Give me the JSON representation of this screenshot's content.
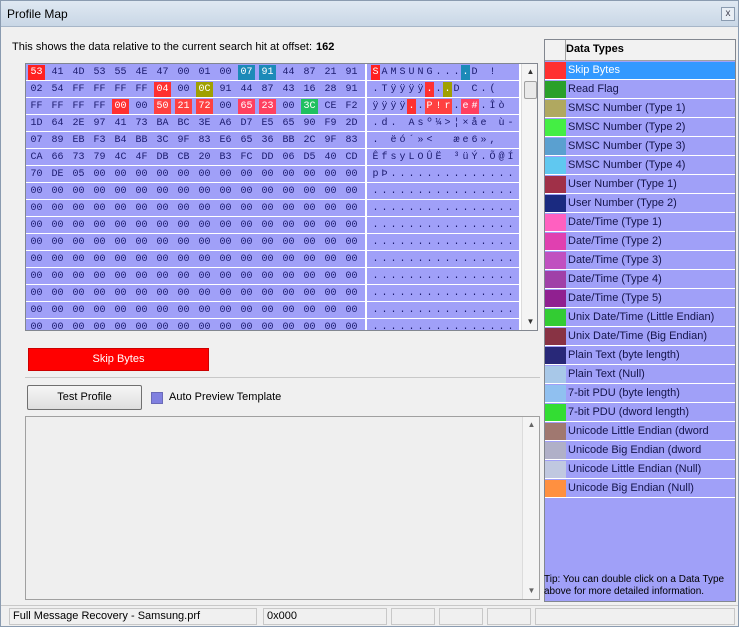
{
  "window": {
    "title": "Profile Map",
    "close_label": "x"
  },
  "info": {
    "text": "This shows the data relative to the current search hit at offset:",
    "offset": "162"
  },
  "hex_rows": [
    {
      "hex": [
        "53",
        "41",
        "4D",
        "53",
        "55",
        "4E",
        "47",
        "00",
        "01",
        "00",
        "07",
        "91",
        "44",
        "87",
        "21",
        "91"
      ],
      "ascii": [
        "S",
        "A",
        "M",
        "S",
        "U",
        "N",
        "G",
        ".",
        ".",
        ".",
        ".",
        "D",
        " ",
        "!",
        " ",
        " "
      ]
    },
    {
      "hex": [
        "02",
        "54",
        "FF",
        "FF",
        "FF",
        "FF",
        "04",
        "00",
        "0C",
        "91",
        "44",
        "87",
        "43",
        "16",
        "28",
        "91"
      ],
      "ascii": [
        ".",
        "T",
        "ÿ",
        "ÿ",
        "ÿ",
        "ÿ",
        ".",
        ".",
        ".",
        "D",
        " ",
        "C",
        ".",
        "(",
        " ",
        " "
      ]
    },
    {
      "hex": [
        "FF",
        "FF",
        "FF",
        "FF",
        "00",
        "00",
        "50",
        "21",
        "72",
        "00",
        "65",
        "23",
        "00",
        "3C",
        "CE",
        "F2"
      ],
      "ascii": [
        "ÿ",
        "ÿ",
        "ÿ",
        "ÿ",
        ".",
        ".",
        "P",
        "!",
        "r",
        ".",
        "e",
        "#",
        ".",
        "Î",
        "ò",
        " "
      ]
    },
    {
      "hex": [
        "1D",
        "64",
        "2E",
        "97",
        "41",
        "73",
        "BA",
        "BC",
        "3E",
        "A6",
        "D7",
        "E5",
        "65",
        "90",
        "F9",
        "2D"
      ],
      "ascii": [
        ".",
        "d",
        ".",
        " ",
        "A",
        "s",
        "º",
        "¼",
        ">",
        "¦",
        "×",
        "å",
        "e",
        " ",
        "ù",
        "-"
      ]
    },
    {
      "hex": [
        "07",
        "89",
        "EB",
        "F3",
        "B4",
        "BB",
        "3C",
        "9F",
        "83",
        "E6",
        "65",
        "36",
        "BB",
        "2C",
        "9F",
        "83"
      ],
      "ascii": [
        ".",
        " ",
        "ë",
        "ó",
        "´",
        "»",
        "<",
        " ",
        " ",
        "æ",
        "e",
        "6",
        "»",
        ",",
        " ",
        " "
      ]
    },
    {
      "hex": [
        "CA",
        "66",
        "73",
        "79",
        "4C",
        "4F",
        "DB",
        "CB",
        "20",
        "B3",
        "FC",
        "DD",
        "06",
        "D5",
        "40",
        "CD"
      ],
      "ascii": [
        "Ê",
        "f",
        "s",
        "y",
        "L",
        "O",
        "Û",
        "Ë",
        " ",
        "³",
        "ü",
        "Ý",
        ".",
        "Õ",
        "@",
        "Í"
      ]
    },
    {
      "hex": [
        "70",
        "DE",
        "05",
        "00",
        "00",
        "00",
        "00",
        "00",
        "00",
        "00",
        "00",
        "00",
        "00",
        "00",
        "00",
        "00"
      ],
      "ascii": [
        "p",
        "Þ",
        ".",
        ".",
        ".",
        ".",
        ".",
        ".",
        ".",
        ".",
        ".",
        ".",
        ".",
        ".",
        ".",
        "."
      ]
    },
    {
      "hex": [
        "00",
        "00",
        "00",
        "00",
        "00",
        "00",
        "00",
        "00",
        "00",
        "00",
        "00",
        "00",
        "00",
        "00",
        "00",
        "00"
      ],
      "ascii": [
        ".",
        ".",
        ".",
        ".",
        ".",
        ".",
        ".",
        ".",
        ".",
        ".",
        ".",
        ".",
        ".",
        ".",
        ".",
        "."
      ]
    },
    {
      "hex": [
        "00",
        "00",
        "00",
        "00",
        "00",
        "00",
        "00",
        "00",
        "00",
        "00",
        "00",
        "00",
        "00",
        "00",
        "00",
        "00"
      ],
      "ascii": [
        ".",
        ".",
        ".",
        ".",
        ".",
        ".",
        ".",
        ".",
        ".",
        ".",
        ".",
        ".",
        ".",
        ".",
        ".",
        "."
      ]
    },
    {
      "hex": [
        "00",
        "00",
        "00",
        "00",
        "00",
        "00",
        "00",
        "00",
        "00",
        "00",
        "00",
        "00",
        "00",
        "00",
        "00",
        "00"
      ],
      "ascii": [
        ".",
        ".",
        ".",
        ".",
        ".",
        ".",
        ".",
        ".",
        ".",
        ".",
        ".",
        ".",
        ".",
        ".",
        ".",
        "."
      ]
    },
    {
      "hex": [
        "00",
        "00",
        "00",
        "00",
        "00",
        "00",
        "00",
        "00",
        "00",
        "00",
        "00",
        "00",
        "00",
        "00",
        "00",
        "00"
      ],
      "ascii": [
        ".",
        ".",
        ".",
        ".",
        ".",
        ".",
        ".",
        ".",
        ".",
        ".",
        ".",
        ".",
        ".",
        ".",
        ".",
        "."
      ]
    },
    {
      "hex": [
        "00",
        "00",
        "00",
        "00",
        "00",
        "00",
        "00",
        "00",
        "00",
        "00",
        "00",
        "00",
        "00",
        "00",
        "00",
        "00"
      ],
      "ascii": [
        ".",
        ".",
        ".",
        ".",
        ".",
        ".",
        ".",
        ".",
        ".",
        ".",
        ".",
        ".",
        ".",
        ".",
        ".",
        "."
      ]
    },
    {
      "hex": [
        "00",
        "00",
        "00",
        "00",
        "00",
        "00",
        "00",
        "00",
        "00",
        "00",
        "00",
        "00",
        "00",
        "00",
        "00",
        "00"
      ],
      "ascii": [
        ".",
        ".",
        ".",
        ".",
        ".",
        ".",
        ".",
        ".",
        ".",
        ".",
        ".",
        ".",
        ".",
        ".",
        ".",
        "."
      ]
    },
    {
      "hex": [
        "00",
        "00",
        "00",
        "00",
        "00",
        "00",
        "00",
        "00",
        "00",
        "00",
        "00",
        "00",
        "00",
        "00",
        "00",
        "00"
      ],
      "ascii": [
        ".",
        ".",
        ".",
        ".",
        ".",
        ".",
        ".",
        ".",
        ".",
        ".",
        ".",
        ".",
        ".",
        ".",
        ".",
        "."
      ]
    },
    {
      "hex": [
        "00",
        "00",
        "00",
        "00",
        "00",
        "00",
        "00",
        "00",
        "00",
        "00",
        "00",
        "00",
        "00",
        "00",
        "00",
        "00"
      ],
      "ascii": [
        ".",
        ".",
        ".",
        ".",
        ".",
        ".",
        ".",
        ".",
        ".",
        ".",
        ".",
        ".",
        ".",
        ".",
        ".",
        "."
      ]
    },
    {
      "hex": [
        "00",
        "00",
        "00",
        "00",
        "00",
        "00",
        "00",
        "00",
        "00",
        "00",
        "00",
        "00",
        "00",
        "00",
        "00",
        "00"
      ],
      "ascii": [
        ".",
        ".",
        ".",
        ".",
        ".",
        ".",
        ".",
        ".",
        ".",
        ".",
        ".",
        ".",
        ".",
        ".",
        ".",
        "."
      ]
    }
  ],
  "hex_highlights": [
    {
      "row": 0,
      "col": 0,
      "color": "#ff2020"
    },
    {
      "row": 0,
      "col": 10,
      "color": "#1c8ab8"
    },
    {
      "row": 0,
      "col": 11,
      "color": "#1c8ab8"
    },
    {
      "row": 1,
      "col": 6,
      "color": "#ff3030"
    },
    {
      "row": 1,
      "col": 8,
      "color": "#a0a000"
    },
    {
      "row": 2,
      "col": 4,
      "color": "#ff3030"
    },
    {
      "row": 2,
      "col": 6,
      "color": "#ff4040"
    },
    {
      "row": 2,
      "col": 7,
      "color": "#ff4040"
    },
    {
      "row": 2,
      "col": 8,
      "color": "#ff4040"
    },
    {
      "row": 2,
      "col": 10,
      "color": "#ff4060"
    },
    {
      "row": 2,
      "col": 11,
      "color": "#ff4060"
    },
    {
      "row": 2,
      "col": 13,
      "color": "#20c060"
    }
  ],
  "ascii_highlights": [
    {
      "row": 0,
      "col": 0,
      "color": "#ff2020"
    },
    {
      "row": 0,
      "col": 10,
      "color": "#1c8ab8"
    },
    {
      "row": 1,
      "col": 6,
      "color": "#ff3030"
    },
    {
      "row": 1,
      "col": 8,
      "color": "#a0a000"
    },
    {
      "row": 2,
      "col": 4,
      "color": "#ff3030"
    },
    {
      "row": 2,
      "col": 6,
      "color": "#ff4040"
    },
    {
      "row": 2,
      "col": 7,
      "color": "#ff4040"
    },
    {
      "row": 2,
      "col": 8,
      "color": "#ff4040"
    },
    {
      "row": 2,
      "col": 10,
      "color": "#ff4060"
    },
    {
      "row": 2,
      "col": 11,
      "color": "#ff4060"
    }
  ],
  "legend": {
    "label": "Skip Bytes",
    "color": "#ff0000"
  },
  "buttons": {
    "test_profile": "Test Profile"
  },
  "auto_preview": {
    "label": "Auto Preview Template",
    "checked": true
  },
  "data_types": {
    "header": "Data Types",
    "items": [
      {
        "label": "Skip Bytes",
        "color": "#ff3030",
        "selected": true
      },
      {
        "label": "Read Flag",
        "color": "#2aa02a"
      },
      {
        "label": "SMSC Number (Type 1)",
        "color": "#b0a860"
      },
      {
        "label": "SMSC Number (Type 2)",
        "color": "#44ee44"
      },
      {
        "label": "SMSC Number (Type 3)",
        "color": "#5aa0d0"
      },
      {
        "label": "SMSC Number (Type 4)",
        "color": "#60c8f0"
      },
      {
        "label": "User Number (Type 1)",
        "color": "#a03048"
      },
      {
        "label": "User Number (Type 2)",
        "color": "#1a2a80"
      },
      {
        "label": "Date/Time (Type 1)",
        "color": "#ff60c0"
      },
      {
        "label": "Date/Time (Type 2)",
        "color": "#e040b0"
      },
      {
        "label": "Date/Time (Type 3)",
        "color": "#c050c0"
      },
      {
        "label": "Date/Time (Type 4)",
        "color": "#a040a8"
      },
      {
        "label": "Date/Time (Type 5)",
        "color": "#902090"
      },
      {
        "label": "Unix Date/Time (Little Endian)",
        "color": "#33cc33"
      },
      {
        "label": "Unix Date/Time (Big Endian)",
        "color": "#883344"
      },
      {
        "label": "Plain Text (byte length)",
        "color": "#282878"
      },
      {
        "label": "Plain Text (Null)",
        "color": "#a8c8e8"
      },
      {
        "label": "7-bit PDU (byte length)",
        "color": "#90c0f0"
      },
      {
        "label": "7-bit PDU (dword length)",
        "color": "#33dd33"
      },
      {
        "label": "Unicode Little Endian (dword",
        "color": "#a07870"
      },
      {
        "label": "Unicode Big Endian (dword",
        "color": "#b0b0c8"
      },
      {
        "label": "Unicode Little Endian (Null)",
        "color": "#c0c8e0"
      },
      {
        "label": "Unicode Big Endian (Null)",
        "color": "#ff9040"
      }
    ]
  },
  "tip": "Tip: You can double click on a Data Type above for more detailed information.",
  "statusbar": {
    "profile": "Full Message Recovery - Samsung.prf",
    "offset": "0x000"
  },
  "colors": {
    "accent": "#a0a0f8",
    "selection": "#3399ff"
  }
}
